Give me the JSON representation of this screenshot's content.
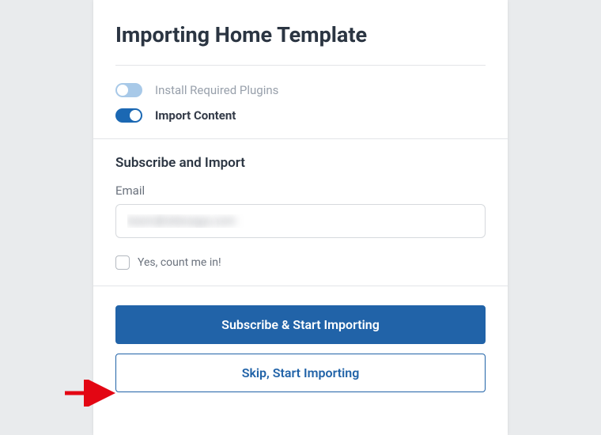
{
  "title": "Importing Home Template",
  "toggles": {
    "plugins": {
      "label": "Install Required Plugins",
      "on": false
    },
    "content": {
      "label": "Import Content",
      "on": true
    }
  },
  "subscribe": {
    "heading": "Subscribe and Import",
    "email_label": "Email",
    "email_value": "team@sitesaga.com",
    "checkbox_label": "Yes, count me in!"
  },
  "actions": {
    "primary": "Subscribe & Start Importing",
    "secondary": "Skip, Start Importing"
  },
  "colors": {
    "brand": "#2163a8",
    "toggle_on": "#1b68b3",
    "toggle_off": "#a8c9e8",
    "arrow": "#e30613"
  }
}
